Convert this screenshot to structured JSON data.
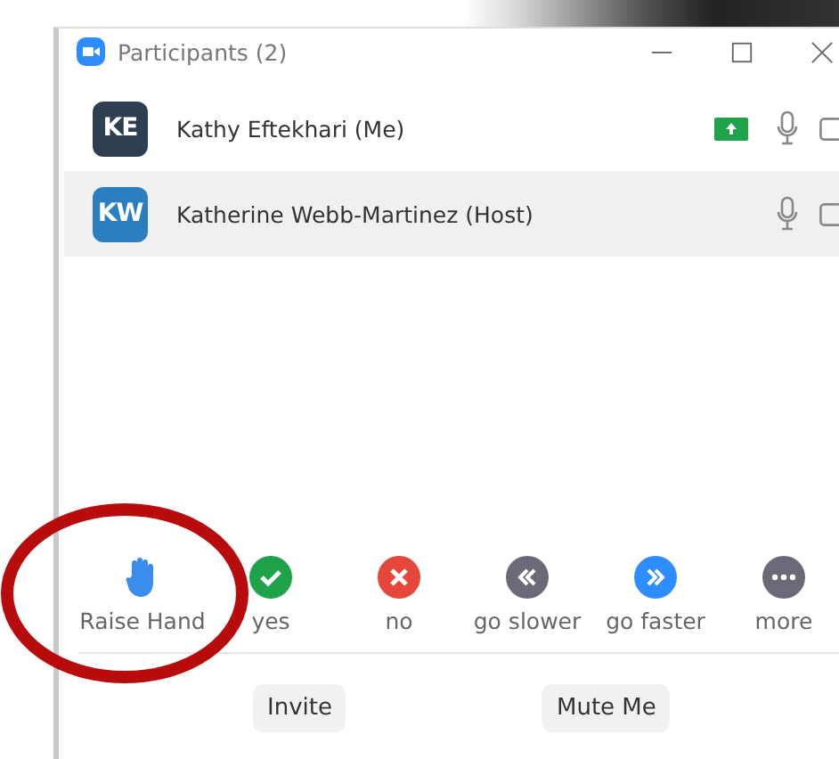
{
  "window": {
    "title": "Participants (2)"
  },
  "participants": [
    {
      "initials": "KE",
      "name": "Kathy Eftekhari (Me)",
      "color": "#2e3f52",
      "sharing": true,
      "selected": false
    },
    {
      "initials": "KW",
      "name": "Katherine Webb-Martinez (Host)",
      "color": "#2b7fc1",
      "sharing": false,
      "selected": true
    }
  ],
  "reactions": [
    {
      "kind": "hand",
      "label": "Raise Hand"
    },
    {
      "kind": "yes",
      "label": "yes"
    },
    {
      "kind": "no",
      "label": "no"
    },
    {
      "kind": "slower",
      "label": "go slower"
    },
    {
      "kind": "faster",
      "label": "go faster"
    },
    {
      "kind": "more",
      "label": "more"
    }
  ],
  "buttons": [
    "Invite",
    "Mute Me"
  ]
}
